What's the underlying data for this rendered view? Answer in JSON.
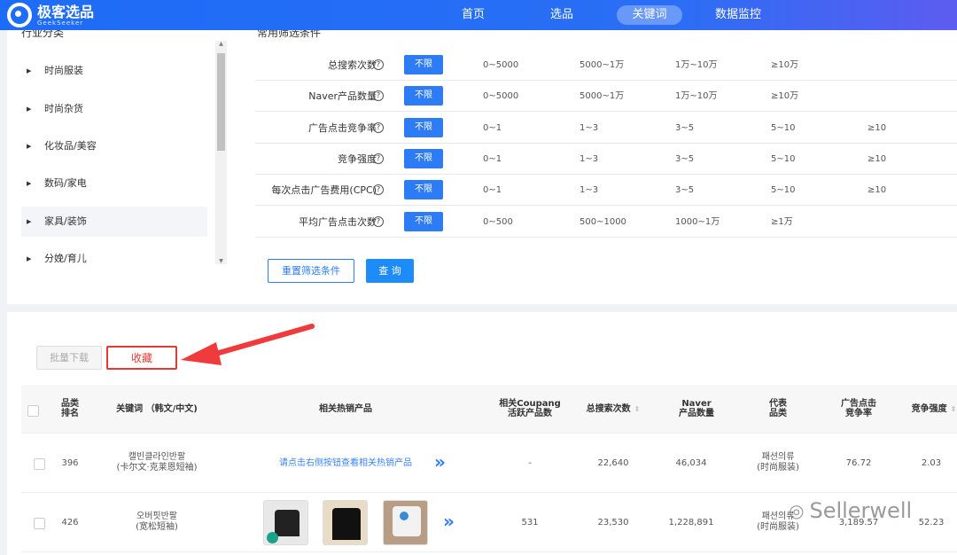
{
  "header": {
    "logo_cn": "极客选品",
    "logo_en": "GeekSeeker",
    "nav": [
      {
        "label": "首页"
      },
      {
        "label": "选品"
      },
      {
        "label": "关键词",
        "active": true
      },
      {
        "label": "数据监控"
      }
    ]
  },
  "sidebar": {
    "title": "行业分类",
    "categories": [
      "时尚服装",
      "时尚杂货",
      "化妆品/美容",
      "数码/家电",
      "家具/装饰",
      "分娩/育儿"
    ],
    "selected": "家具/装饰"
  },
  "filters": {
    "title": "常用筛选条件",
    "unlimited_label": "不限",
    "rows": [
      {
        "label": "总搜索次数",
        "options": [
          "0~5000",
          "5000~1万",
          "1万~10万",
          "≥10万"
        ]
      },
      {
        "label": "Naver产品数量",
        "options": [
          "0~5000",
          "5000~1万",
          "1万~10万",
          "≥10万"
        ]
      },
      {
        "label": "广告点击竞争率",
        "options": [
          "0~1",
          "1~3",
          "3~5",
          "5~10",
          "≥10"
        ]
      },
      {
        "label": "竞争强度",
        "options": [
          "0~1",
          "1~3",
          "3~5",
          "5~10",
          "≥10"
        ]
      },
      {
        "label": "每次点击广告费用(CPC)",
        "options": [
          "0~1",
          "1~3",
          "3~5",
          "5~10",
          "≥10"
        ]
      },
      {
        "label": "平均广告点击次数",
        "options": [
          "0~500",
          "500~1000",
          "1000~1万",
          "≥1万"
        ]
      }
    ],
    "reset_label": "重置筛选条件",
    "query_label": "查 询"
  },
  "actions": {
    "batch_download": "批量下载",
    "favorite": "收藏"
  },
  "table": {
    "headers": {
      "rank": [
        "品类",
        "排名"
      ],
      "keyword": "关键词 （韩文/中文)",
      "products": "相关热销产品",
      "coupang": [
        "相关Coupang",
        "活跃产品数"
      ],
      "search": "总搜索次数",
      "naver": [
        "Naver",
        "产品数量"
      ],
      "category": [
        "代表",
        "品类"
      ],
      "ad_rate": [
        "广告点击",
        "竞争率"
      ],
      "competition": "竞争强度"
    },
    "rows": [
      {
        "rank": "396",
        "kw_ko": "캘빈클라인반팔",
        "kw_cn": "(卡尔文·克莱恩短袖)",
        "products_hint": "请点击右侧按钮查看相关热销产品",
        "coupang": "-",
        "search": "22,640",
        "naver": "46,034",
        "cat_ko": "패션의류",
        "cat_cn": "(时尚服装)",
        "ad_rate": "76.72",
        "competition": "2.03"
      },
      {
        "rank": "426",
        "kw_ko": "오버핏반팔",
        "kw_cn": "(宽松短袖)",
        "products_hint": "",
        "coupang": "531",
        "search": "23,530",
        "naver": "1,228,891",
        "cat_ko": "패션의류",
        "cat_cn": "(时尚服装)",
        "ad_rate": "3,189.57",
        "competition": "52.23"
      }
    ]
  },
  "watermark": "Sellerwell"
}
